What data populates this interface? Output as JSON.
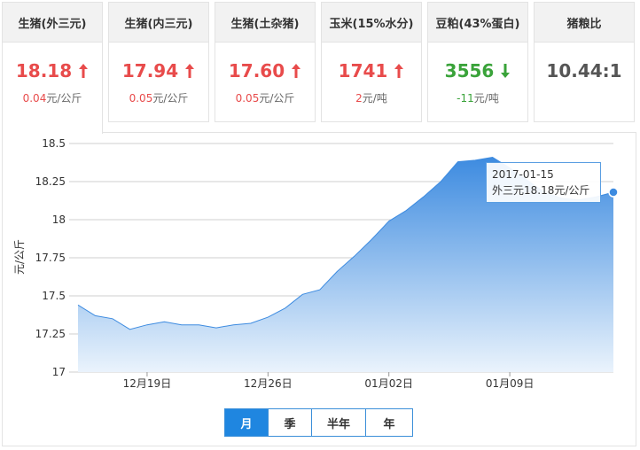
{
  "cards": [
    {
      "title": "生猪(外三元)",
      "price": "18.18",
      "direction": "up",
      "change_value": "0.04",
      "change_unit": "元/公斤"
    },
    {
      "title": "生猪(内三元)",
      "price": "17.94",
      "direction": "up",
      "change_value": "0.05",
      "change_unit": "元/公斤"
    },
    {
      "title": "生猪(土杂猪)",
      "price": "17.60",
      "direction": "up",
      "change_value": "0.05",
      "change_unit": "元/公斤"
    },
    {
      "title": "玉米(15%水分)",
      "price": "1741",
      "direction": "up",
      "change_value": "2",
      "change_unit": "元/吨"
    },
    {
      "title": "豆粕(43%蛋白)",
      "price": "3556",
      "direction": "down",
      "change_value": "-11",
      "change_unit": "元/吨"
    },
    {
      "title": "猪粮比",
      "price": "10.44:1",
      "direction": "none",
      "change_value": "",
      "change_unit": ""
    }
  ],
  "tooltip": {
    "date": "2017-01-15",
    "text": "外三元18.18元/公斤"
  },
  "periods": [
    "月",
    "季",
    "半年",
    "年"
  ],
  "selected_period": "月",
  "colors": {
    "up": "#e84b4b",
    "down": "#3aa33a",
    "accent": "#1f86e0",
    "area_top": "#3d8be0",
    "area_bottom": "#eaf3fc"
  },
  "icons": {
    "up": "arrow-up-icon",
    "down": "arrow-down-icon"
  },
  "chart_data": {
    "type": "area",
    "series_name": "外三元",
    "ylabel": "元/公斤",
    "ylim": [
      17,
      18.5
    ],
    "yticks": [
      "17",
      "17.25",
      "17.5",
      "17.75",
      "18",
      "18.25",
      "18.5"
    ],
    "xticks": [
      "12月19日",
      "12月26日",
      "01月02日",
      "01月09日"
    ],
    "x": [
      "2016-12-15",
      "2016-12-16",
      "2016-12-17",
      "2016-12-18",
      "2016-12-19",
      "2016-12-20",
      "2016-12-21",
      "2016-12-22",
      "2016-12-23",
      "2016-12-24",
      "2016-12-25",
      "2016-12-26",
      "2016-12-27",
      "2016-12-28",
      "2016-12-29",
      "2016-12-30",
      "2016-12-31",
      "2017-01-01",
      "2017-01-02",
      "2017-01-03",
      "2017-01-04",
      "2017-01-05",
      "2017-01-06",
      "2017-01-07",
      "2017-01-08",
      "2017-01-09",
      "2017-01-10",
      "2017-01-11",
      "2017-01-12",
      "2017-01-13",
      "2017-01-14",
      "2017-01-15"
    ],
    "values": [
      17.44,
      17.37,
      17.35,
      17.28,
      17.31,
      17.33,
      17.31,
      17.31,
      17.29,
      17.31,
      17.32,
      17.36,
      17.42,
      17.51,
      17.54,
      17.66,
      17.76,
      17.87,
      17.99,
      18.06,
      18.15,
      18.25,
      18.38,
      18.39,
      18.41,
      18.34,
      18.26,
      18.18,
      18.14,
      18.13,
      18.15,
      18.18
    ],
    "grid": true,
    "highlight_point": {
      "x": "2017-01-15",
      "y": 18.18
    }
  }
}
